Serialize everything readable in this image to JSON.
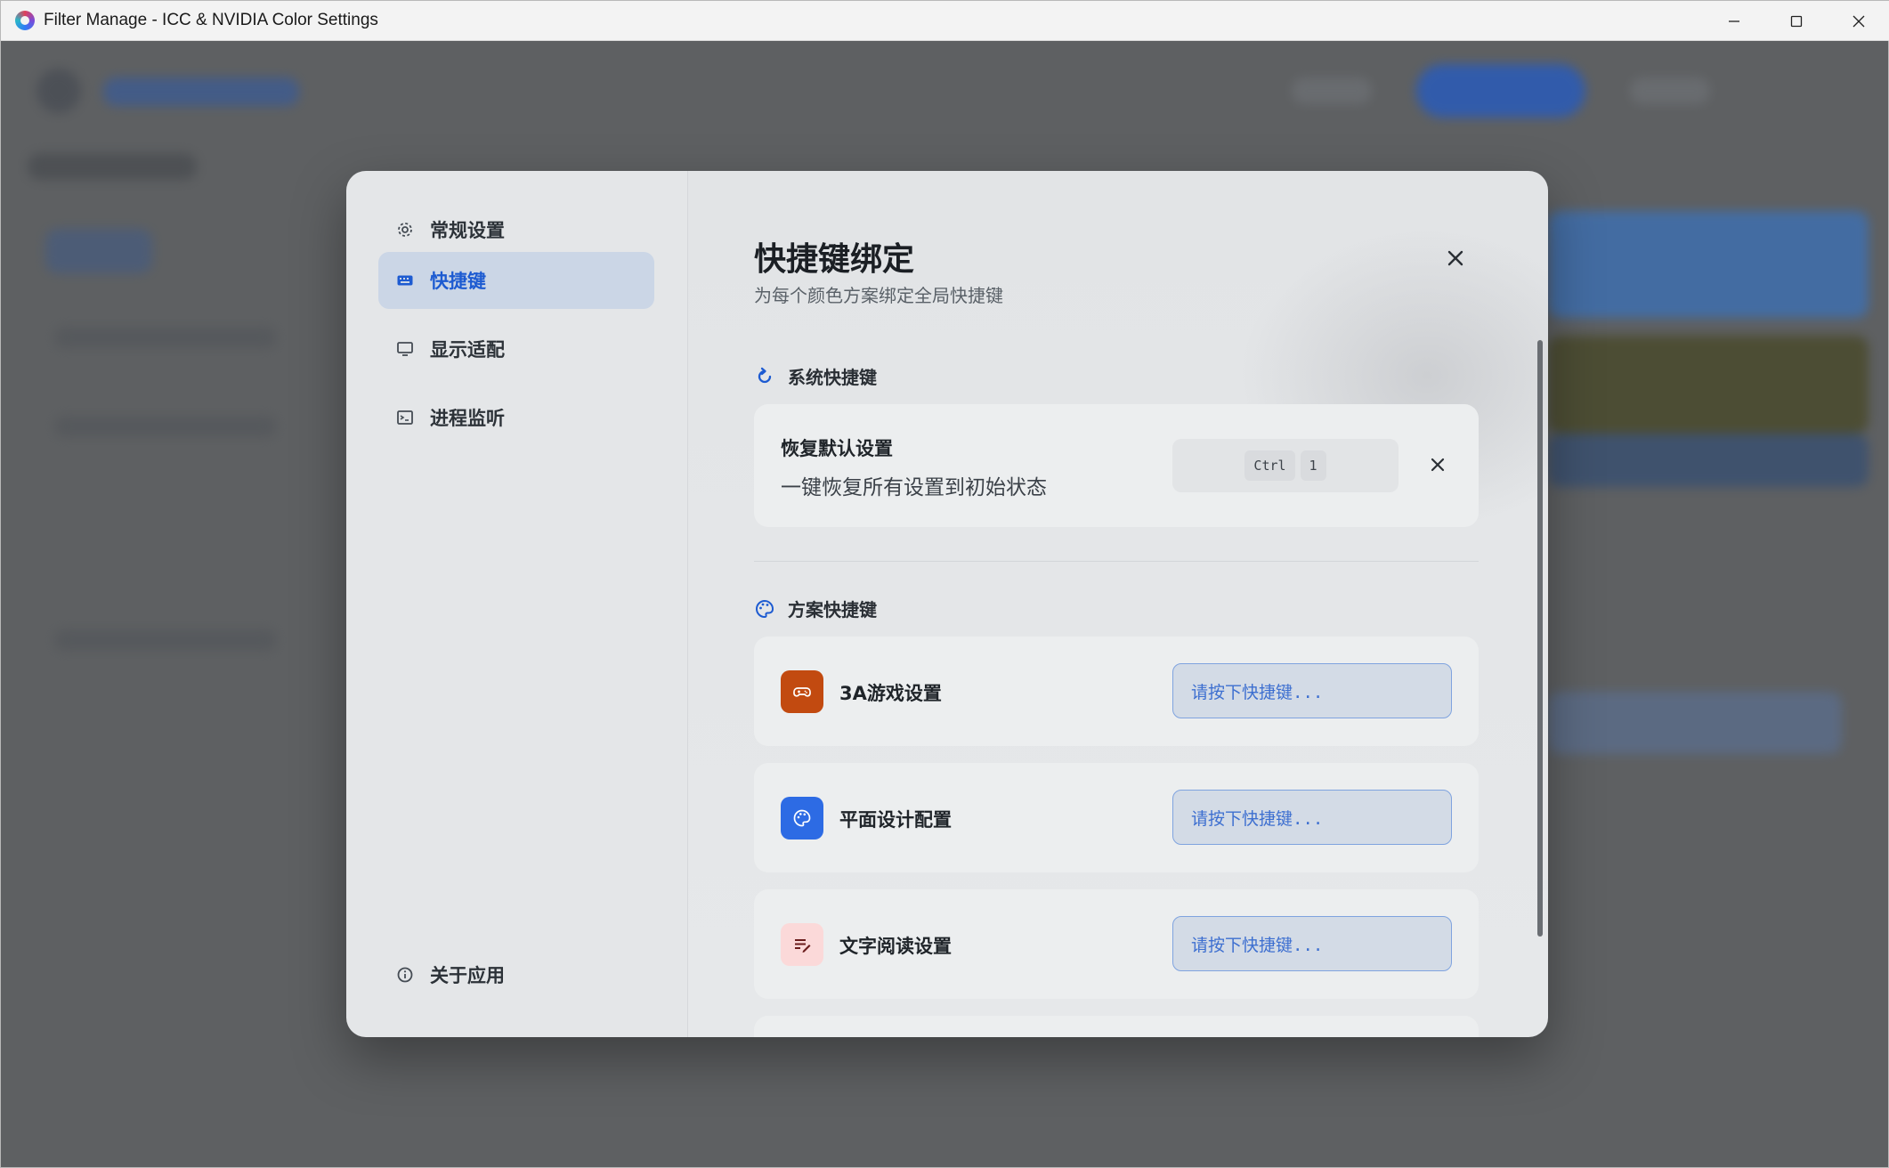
{
  "window": {
    "title": "Filter Manage - ICC & NVIDIA Color Settings",
    "controls": {
      "minimize": "—",
      "maximize": "☐",
      "close": "✕"
    }
  },
  "sidebar": {
    "items": [
      {
        "label": "常规设置",
        "icon": "gear-icon",
        "active": false
      },
      {
        "label": "快捷键",
        "icon": "keyboard-icon",
        "active": true
      },
      {
        "label": "显示适配",
        "icon": "monitor-icon",
        "active": false
      },
      {
        "label": "进程监听",
        "icon": "terminal-icon",
        "active": false
      }
    ],
    "about": {
      "label": "关于应用",
      "icon": "info-icon"
    }
  },
  "content": {
    "title": "快捷键绑定",
    "subtitle": "为每个颜色方案绑定全局快捷键",
    "system_section": {
      "heading": "系统快捷键",
      "icon": "refresh-icon",
      "item": {
        "title": "恢复默认设置",
        "description": "一键恢复所有设置到初始状态",
        "keys": [
          "Ctrl",
          "1"
        ]
      }
    },
    "scheme_section": {
      "heading": "方案快捷键",
      "icon": "palette-icon",
      "items": [
        {
          "name": "3A游戏设置",
          "icon": "gamepad-icon",
          "icon_color": "#c24a10",
          "placeholder": "请按下快捷键..."
        },
        {
          "name": "平面设计配置",
          "icon": "palette-icon",
          "icon_color": "#2d6be4",
          "placeholder": "请按下快捷键..."
        },
        {
          "name": "文字阅读设置",
          "icon": "reading-icon",
          "icon_color": "#fbd9d9",
          "placeholder": "请按下快捷键..."
        }
      ]
    }
  },
  "colors": {
    "accent": "#1d5bd1",
    "active_nav_bg": "#cbd6e6",
    "input_border": "#7fa3df"
  }
}
